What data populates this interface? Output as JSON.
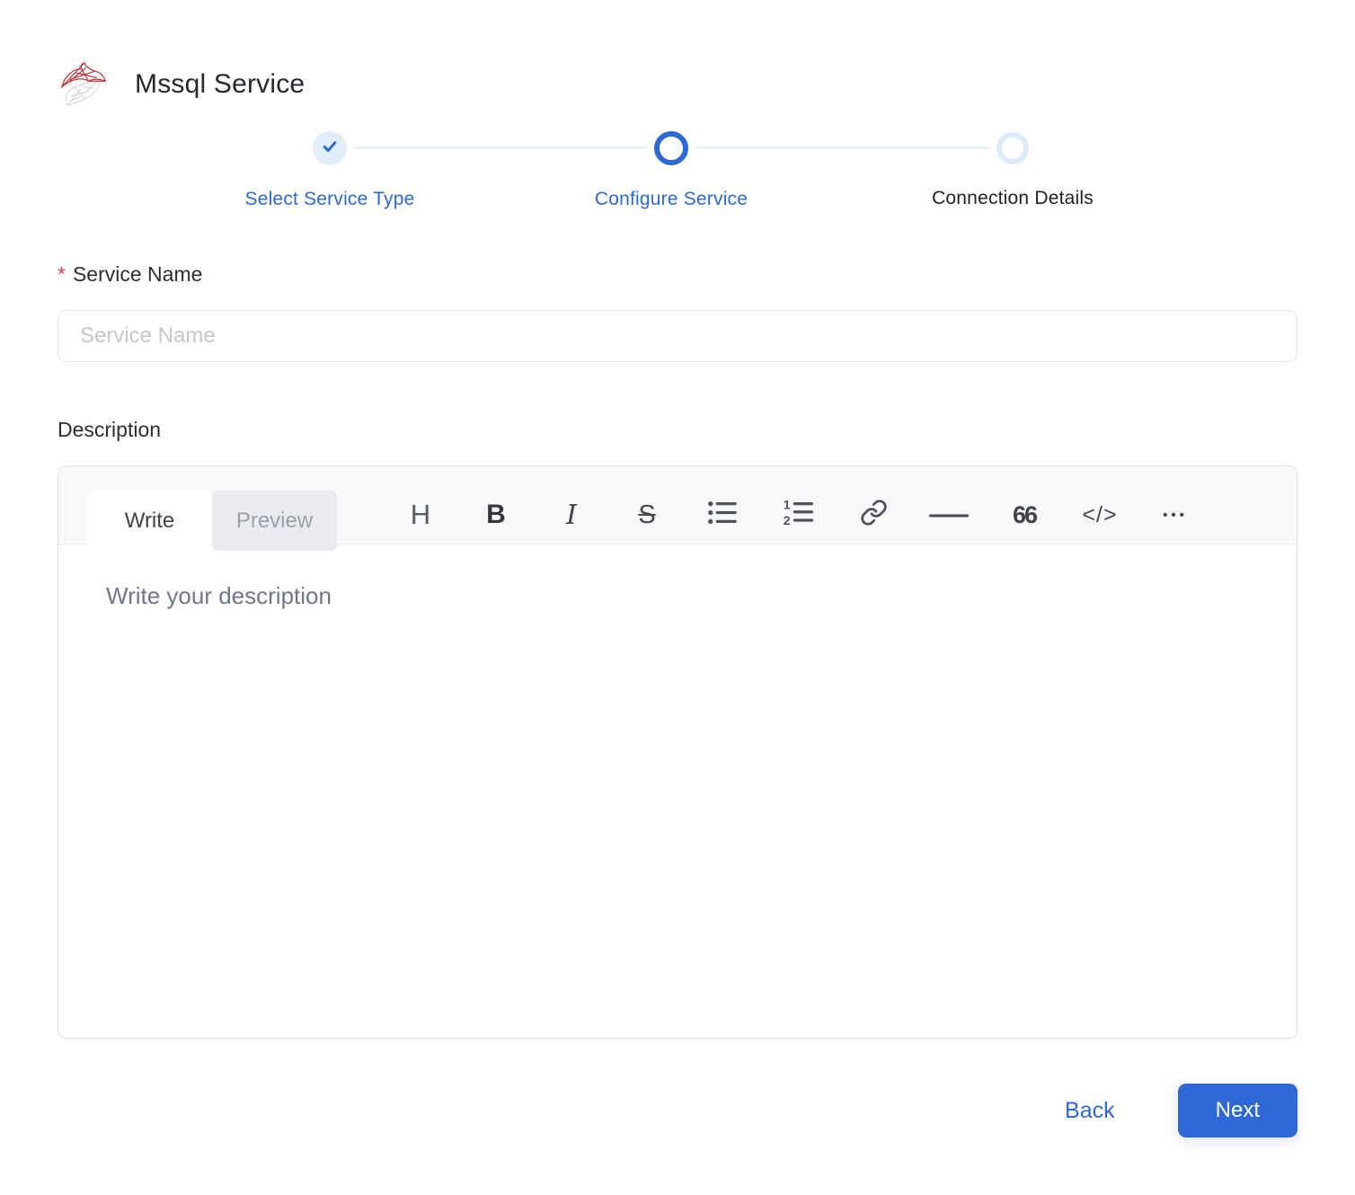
{
  "header": {
    "title": "Mssql Service",
    "logo": "mssql-logo"
  },
  "stepper": {
    "steps": [
      {
        "label": "Select Service Type",
        "state": "completed"
      },
      {
        "label": "Configure Service",
        "state": "active"
      },
      {
        "label": "Connection Details",
        "state": "pending"
      }
    ]
  },
  "form": {
    "service_name": {
      "required_marker": "*",
      "label": "Service Name",
      "placeholder": "Service Name",
      "value": ""
    },
    "description": {
      "label": "Description",
      "editor": {
        "tabs": [
          {
            "label": "Write",
            "active": true
          },
          {
            "label": "Preview",
            "active": false
          }
        ],
        "toolbar": [
          {
            "name": "heading",
            "glyph": "H"
          },
          {
            "name": "bold",
            "glyph": "B"
          },
          {
            "name": "italic",
            "glyph": "I"
          },
          {
            "name": "strikethrough",
            "glyph": "S"
          },
          {
            "name": "unordered-list",
            "glyph": ""
          },
          {
            "name": "ordered-list",
            "glyph": ""
          },
          {
            "name": "link",
            "glyph": ""
          },
          {
            "name": "horizontal-rule",
            "glyph": "—"
          },
          {
            "name": "quote",
            "glyph": "66"
          },
          {
            "name": "code",
            "glyph": "</>"
          },
          {
            "name": "more",
            "glyph": "•••"
          }
        ],
        "placeholder": "Write your description",
        "value": ""
      }
    }
  },
  "actions": {
    "back_label": "Back",
    "next_label": "Next"
  },
  "colors": {
    "accent_blue": "#2e68d4",
    "completed_step_bg": "#e1edfb",
    "pending_ring": "#ddeafc",
    "connector_line": "#e9f1fc",
    "required_red": "#e5484d",
    "toolbar_bg": "#f7f8fa",
    "logo_red": "#b6292d",
    "logo_gray": "#c9d0d6"
  }
}
